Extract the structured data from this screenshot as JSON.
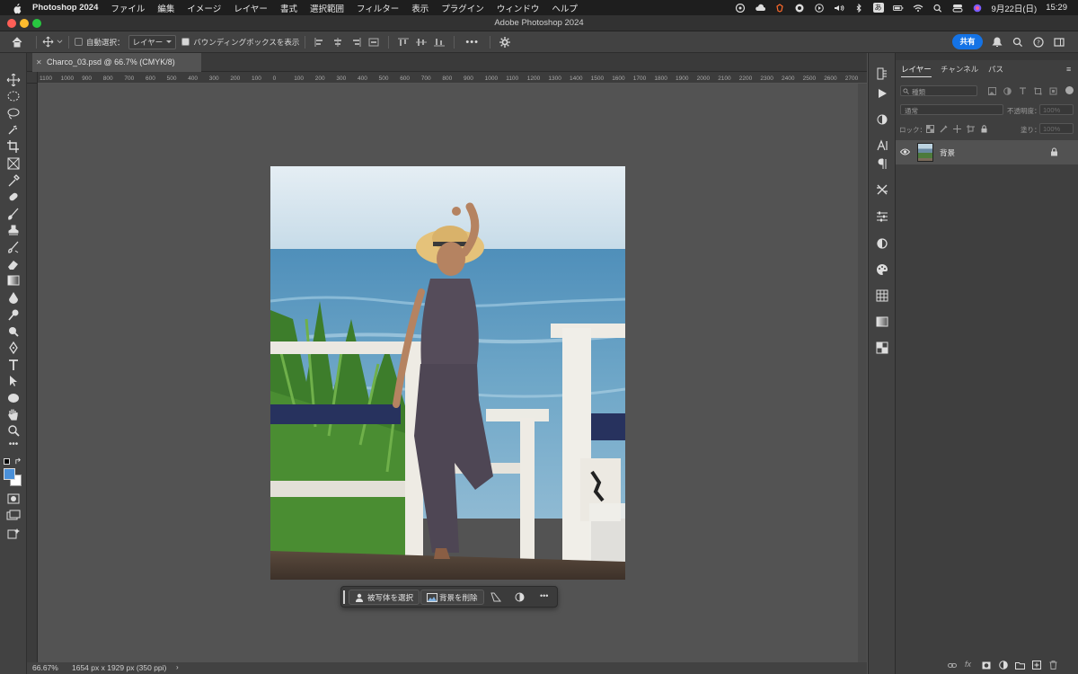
{
  "menubar": {
    "app_name": "Photoshop 2024",
    "items": [
      "ファイル",
      "編集",
      "イメージ",
      "レイヤー",
      "書式",
      "選択範囲",
      "フィルター",
      "表示",
      "プラグイン",
      "ウィンドウ",
      "ヘルプ"
    ],
    "input_method": "あ",
    "date": "9月22日(日)",
    "time": "15:29"
  },
  "window": {
    "title": "Adobe Photoshop 2024"
  },
  "options_bar": {
    "auto_select_label": "自動選択：",
    "auto_select_checked": false,
    "target_value": "レイヤー",
    "bounding_box_label": "バウンディングボックスを表示",
    "bounding_box_checked": true,
    "share_label": "共有"
  },
  "document": {
    "tab_title": "Charco_03.psd @ 66.7% (CMYK/8)"
  },
  "ruler": {
    "labels": [
      "1100",
      "1000",
      "900",
      "800",
      "700",
      "600",
      "500",
      "400",
      "300",
      "200",
      "100",
      "0",
      "100",
      "200",
      "300",
      "400",
      "500",
      "600",
      "700",
      "800",
      "900",
      "1000",
      "1100",
      "1200",
      "1300",
      "1400",
      "1500",
      "1600",
      "1700",
      "1800",
      "1900",
      "2000",
      "2100",
      "2200",
      "2300",
      "2400",
      "2500",
      "2600",
      "2700"
    ]
  },
  "context_bar": {
    "select_subject": "被写体を選択",
    "remove_background": "背景を削除"
  },
  "status": {
    "zoom": "66.67%",
    "doc_info": "1654 px x 1929 px (350 ppi)"
  },
  "layers_panel": {
    "tabs": [
      "レイヤー",
      "チャンネル",
      "パス"
    ],
    "filter_placeholder": "種類",
    "blend_mode": "通常",
    "opacity_label": "不透明度：",
    "opacity_value": "100%",
    "lock_label": "ロック：",
    "fill_label": "塗り：",
    "fill_value": "100%",
    "layers": [
      {
        "name": "背景",
        "visible": true,
        "locked": true
      }
    ]
  },
  "colors": {
    "accent": "#1473e6",
    "foreground_swatch": "#4a90d9",
    "background_swatch": "#ffffff"
  }
}
